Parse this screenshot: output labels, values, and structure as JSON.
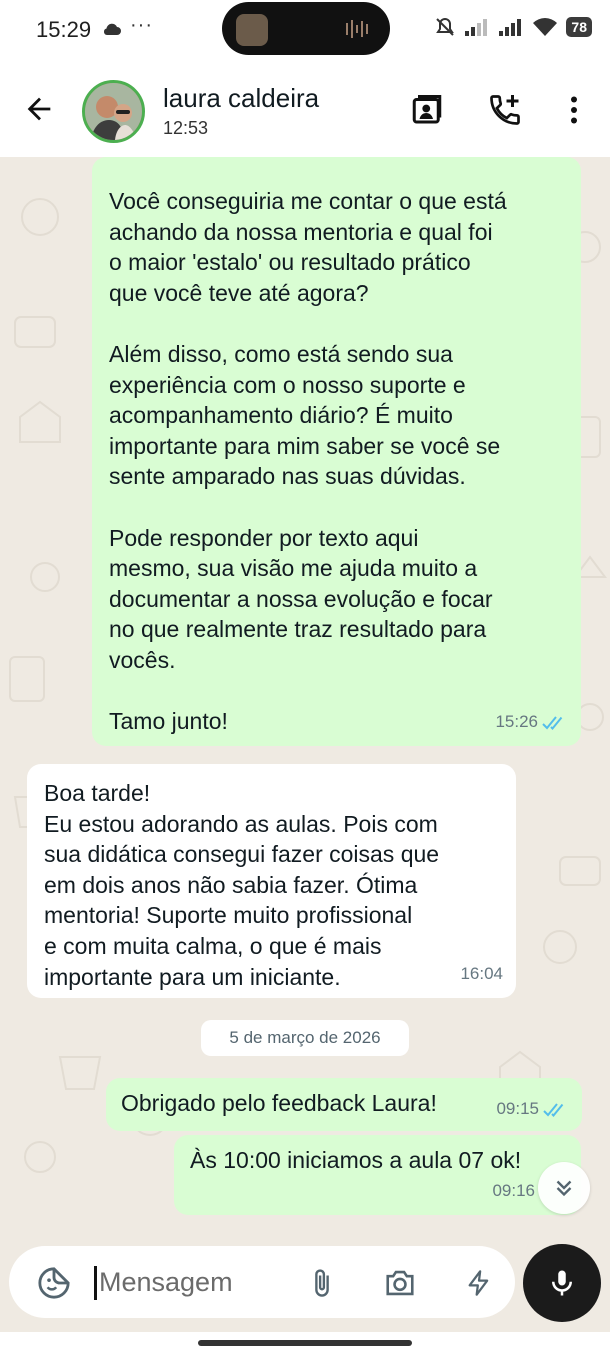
{
  "status_bar": {
    "time": "15:29",
    "dots": "···",
    "battery": "78"
  },
  "header": {
    "contact_name": "laura caldeira",
    "subtitle": "12:53"
  },
  "messages": [
    {
      "direction": "outgoing",
      "text": "Você conseguiria me contar o que está\nachando da nossa mentoria e qual foi\no maior 'estalo' ou resultado prático\nque você teve até agora?\n\nAlém disso, como está sendo sua\nexperiência com o nosso suporte e\nacompanhamento diário? É muito\nimportante para mim saber se você se\nsente amparado nas suas dúvidas.\n\nPode responder por texto aqui\nmesmo, sua visão me ajuda muito a\ndocumentar a nossa evolução e focar\nno que realmente traz resultado para\nvocês.\n\nTamo junto!",
      "time": "15:26",
      "read": true
    },
    {
      "direction": "incoming",
      "text": "Boa tarde!\nEu estou adorando as aulas. Pois com\nsua didática consegui fazer coisas que\nem dois anos não sabia fazer. Ótima\nmentoria! Suporte muito profissional\ne com muita calma, o que é mais\nimportante para um iniciante.",
      "time": "16:04"
    },
    {
      "direction": "outgoing",
      "text": "Obrigado pelo feedback Laura!",
      "time": "09:15",
      "read": true
    },
    {
      "direction": "outgoing",
      "text": "Às 10:00 iniciamos a aula 07 ok!",
      "time": "09:16",
      "read": true
    }
  ],
  "date_separator": "5 de março de 2026",
  "input": {
    "placeholder": "Mensagem"
  },
  "colors": {
    "outgoing_bubble": "#d9fdd3",
    "incoming_bubble": "#ffffff",
    "chat_background": "#efeae2",
    "read_ticks": "#53bdeb",
    "avatar_ring": "#4caf50"
  },
  "icons": [
    "back-arrow-icon",
    "video-call-icon",
    "add-call-icon",
    "more-vert-icon",
    "double-check-icon",
    "chevron-double-down-icon",
    "sticker-icon",
    "attach-icon",
    "camera-icon",
    "lightning-icon",
    "mic-icon",
    "cloud-icon",
    "mute-icon",
    "signal-icon",
    "wifi-icon"
  ]
}
